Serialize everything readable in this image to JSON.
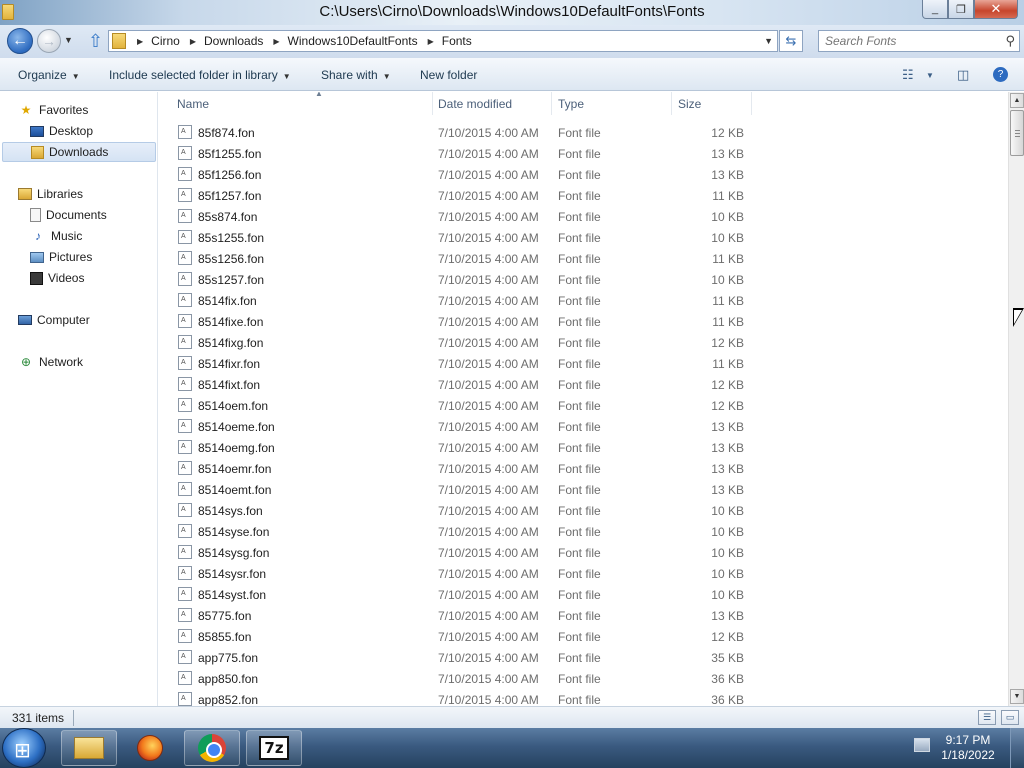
{
  "window": {
    "title": "C:\\Users\\Cirno\\Downloads\\Windows10DefaultFonts\\Fonts",
    "minimize": "▭",
    "maximize": "❐",
    "close": "✕"
  },
  "address": {
    "breadcrumbs": [
      "Cirno",
      "Downloads",
      "Windows10DefaultFonts",
      "Fonts"
    ],
    "search_placeholder": "Search Fonts"
  },
  "toolbar": {
    "organize": "Organize",
    "include_in_library": "Include selected folder in library",
    "share_with": "Share with",
    "new_folder": "New folder"
  },
  "nav": {
    "favorites": "Favorites",
    "desktop": "Desktop",
    "downloads": "Downloads",
    "libraries": "Libraries",
    "documents": "Documents",
    "music": "Music",
    "pictures": "Pictures",
    "videos": "Videos",
    "computer": "Computer",
    "network": "Network"
  },
  "columns": {
    "name": "Name",
    "date_modified": "Date modified",
    "type": "Type",
    "size": "Size"
  },
  "files": [
    {
      "name": "85f874.fon",
      "date": "7/10/2015 4:00 AM",
      "type": "Font file",
      "size": "12 KB"
    },
    {
      "name": "85f1255.fon",
      "date": "7/10/2015 4:00 AM",
      "type": "Font file",
      "size": "13 KB"
    },
    {
      "name": "85f1256.fon",
      "date": "7/10/2015 4:00 AM",
      "type": "Font file",
      "size": "13 KB"
    },
    {
      "name": "85f1257.fon",
      "date": "7/10/2015 4:00 AM",
      "type": "Font file",
      "size": "11 KB"
    },
    {
      "name": "85s874.fon",
      "date": "7/10/2015 4:00 AM",
      "type": "Font file",
      "size": "10 KB"
    },
    {
      "name": "85s1255.fon",
      "date": "7/10/2015 4:00 AM",
      "type": "Font file",
      "size": "10 KB"
    },
    {
      "name": "85s1256.fon",
      "date": "7/10/2015 4:00 AM",
      "type": "Font file",
      "size": "11 KB"
    },
    {
      "name": "85s1257.fon",
      "date": "7/10/2015 4:00 AM",
      "type": "Font file",
      "size": "10 KB"
    },
    {
      "name": "8514fix.fon",
      "date": "7/10/2015 4:00 AM",
      "type": "Font file",
      "size": "11 KB"
    },
    {
      "name": "8514fixe.fon",
      "date": "7/10/2015 4:00 AM",
      "type": "Font file",
      "size": "11 KB"
    },
    {
      "name": "8514fixg.fon",
      "date": "7/10/2015 4:00 AM",
      "type": "Font file",
      "size": "12 KB"
    },
    {
      "name": "8514fixr.fon",
      "date": "7/10/2015 4:00 AM",
      "type": "Font file",
      "size": "11 KB"
    },
    {
      "name": "8514fixt.fon",
      "date": "7/10/2015 4:00 AM",
      "type": "Font file",
      "size": "12 KB"
    },
    {
      "name": "8514oem.fon",
      "date": "7/10/2015 4:00 AM",
      "type": "Font file",
      "size": "12 KB"
    },
    {
      "name": "8514oeme.fon",
      "date": "7/10/2015 4:00 AM",
      "type": "Font file",
      "size": "13 KB"
    },
    {
      "name": "8514oemg.fon",
      "date": "7/10/2015 4:00 AM",
      "type": "Font file",
      "size": "13 KB"
    },
    {
      "name": "8514oemr.fon",
      "date": "7/10/2015 4:00 AM",
      "type": "Font file",
      "size": "13 KB"
    },
    {
      "name": "8514oemt.fon",
      "date": "7/10/2015 4:00 AM",
      "type": "Font file",
      "size": "13 KB"
    },
    {
      "name": "8514sys.fon",
      "date": "7/10/2015 4:00 AM",
      "type": "Font file",
      "size": "10 KB"
    },
    {
      "name": "8514syse.fon",
      "date": "7/10/2015 4:00 AM",
      "type": "Font file",
      "size": "10 KB"
    },
    {
      "name": "8514sysg.fon",
      "date": "7/10/2015 4:00 AM",
      "type": "Font file",
      "size": "10 KB"
    },
    {
      "name": "8514sysr.fon",
      "date": "7/10/2015 4:00 AM",
      "type": "Font file",
      "size": "10 KB"
    },
    {
      "name": "8514syst.fon",
      "date": "7/10/2015 4:00 AM",
      "type": "Font file",
      "size": "10 KB"
    },
    {
      "name": "85775.fon",
      "date": "7/10/2015 4:00 AM",
      "type": "Font file",
      "size": "13 KB"
    },
    {
      "name": "85855.fon",
      "date": "7/10/2015 4:00 AM",
      "type": "Font file",
      "size": "12 KB"
    },
    {
      "name": "app775.fon",
      "date": "7/10/2015 4:00 AM",
      "type": "Font file",
      "size": "35 KB"
    },
    {
      "name": "app850.fon",
      "date": "7/10/2015 4:00 AM",
      "type": "Font file",
      "size": "36 KB"
    },
    {
      "name": "app852.fon",
      "date": "7/10/2015 4:00 AM",
      "type": "Font file",
      "size": "36 KB"
    }
  ],
  "status": {
    "item_count": "331 items"
  },
  "taskbar": {
    "apps": [
      "explorer",
      "firefox",
      "chrome",
      "7z"
    ],
    "sevenzip_label": "7z",
    "time": "9:17 PM",
    "date": "1/18/2022"
  },
  "icons": {
    "file_icon_glyph": "A"
  }
}
